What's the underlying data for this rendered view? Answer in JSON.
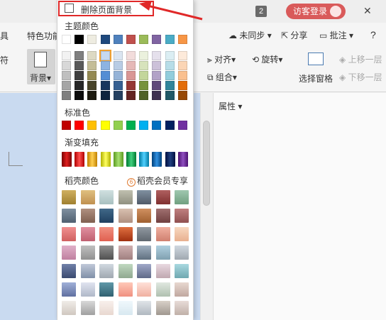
{
  "titlebar": {
    "badge": "2",
    "login_label": "访客登录",
    "close_glyph": "✕"
  },
  "menubar": {
    "left_cut": "具",
    "feature_tab": "特色功能",
    "sync_label": "未同步",
    "share_label": "分享",
    "comment_label": "批注",
    "help_glyph": "?"
  },
  "ribbon": {
    "left_cut": "符",
    "background_label": "背景",
    "align_label": "对齐",
    "rotate_label": "旋转",
    "group_label": "组合",
    "select_pane_label": "选择窗格",
    "up_label": "上移一层",
    "down_label": "下移一层"
  },
  "right_panel": {
    "title": "属性"
  },
  "bg_panel": {
    "delete_label": "删除页面背景",
    "theme_title": "主题颜色",
    "standard_title": "标准色",
    "gradient_title": "渐变填充",
    "shell_title": "稻壳颜色",
    "member_label": "稻壳会员专享",
    "theme_top": [
      "#ffffff",
      "#000000",
      "#eeece1",
      "#1f497d",
      "#4f81bd",
      "#c0504d",
      "#9bbb59",
      "#8064a2",
      "#4bacc6",
      "#f79646"
    ],
    "theme_grid": [
      [
        "#f2f2f2",
        "#7f7f7f",
        "#ddd9c3",
        "#c6d9f0",
        "#dbe5f1",
        "#f2dcdb",
        "#ebf1dd",
        "#e5e0ec",
        "#dbeef3",
        "#fdeada"
      ],
      [
        "#d8d8d8",
        "#595959",
        "#c4bd97",
        "#8db3e2",
        "#b8cce4",
        "#e5b9b7",
        "#d7e3bc",
        "#ccc1d9",
        "#b7dde8",
        "#fbd5b5"
      ],
      [
        "#bfbfbf",
        "#3f3f3f",
        "#938953",
        "#548dd4",
        "#95b3d7",
        "#d99694",
        "#c3d69b",
        "#b2a2c7",
        "#92cddc",
        "#fac08f"
      ],
      [
        "#a5a5a5",
        "#262626",
        "#494429",
        "#17365d",
        "#366092",
        "#953734",
        "#76923c",
        "#5f497a",
        "#31859b",
        "#e36c09"
      ],
      [
        "#7f7f7f",
        "#0c0c0c",
        "#1d1b10",
        "#0f243e",
        "#244061",
        "#632423",
        "#4f6128",
        "#3f3151",
        "#205867",
        "#974806"
      ]
    ],
    "standard": [
      "#c00000",
      "#ff0000",
      "#ffc000",
      "#ffff00",
      "#92d050",
      "#00b050",
      "#00b0f0",
      "#0070c0",
      "#002060",
      "#7030a0"
    ],
    "gradient": [
      [
        "#7a0000",
        "#e02020"
      ],
      [
        "#b00000",
        "#ff5050"
      ],
      [
        "#c08000",
        "#ffd050"
      ],
      [
        "#b0b000",
        "#ffff60"
      ],
      [
        "#5a9a20",
        "#a8e070"
      ],
      [
        "#007a30",
        "#40d080"
      ],
      [
        "#007aa0",
        "#50d0ff"
      ],
      [
        "#00407a",
        "#3090e0"
      ],
      [
        "#001040",
        "#204080"
      ],
      [
        "#4a1070",
        "#9050c0"
      ]
    ],
    "shell": [
      [
        [
          "#a08030",
          "#d0b060"
        ],
        [
          "#c09050",
          "#e0c080"
        ],
        [
          "#a8c0c0",
          "#d0e0e0"
        ],
        [
          "#909080",
          "#c0c0b0"
        ],
        [
          "#505a68",
          "#8090a0"
        ],
        [
          "#803030",
          "#b06060"
        ],
        [
          "#70a080",
          "#a0c8b0"
        ]
      ],
      [
        [
          "#506070",
          "#8090a0"
        ],
        [
          "#806050",
          "#b09080"
        ],
        [
          "#204060",
          "#406888"
        ],
        [
          "#b09080",
          "#d8c0b0"
        ],
        [
          "#a06030",
          "#d09060"
        ],
        [
          "#704040",
          "#a07070"
        ],
        [
          "#905050",
          "#c08080"
        ]
      ],
      [
        [
          "#d06060",
          "#f09090"
        ],
        [
          "#c06070",
          "#e090a0"
        ],
        [
          "#e06050",
          "#f09080"
        ],
        [
          "#a03010",
          "#e07040"
        ],
        [
          "#606870",
          "#9098a0"
        ],
        [
          "#d08070",
          "#f0b0a0"
        ],
        [
          "#e8b090",
          "#f8d8c0"
        ]
      ],
      [
        [
          "#c080a0",
          "#e0b0c8"
        ],
        [
          "#909090",
          "#c0c0c0"
        ],
        [
          "#505050",
          "#909090"
        ],
        [
          "#a08080",
          "#d0b0b0"
        ],
        [
          "#607080",
          "#a0b0c0"
        ],
        [
          "#80a0b0",
          "#b0d0e0"
        ],
        [
          "#a0a8b0",
          "#d0d8e0"
        ]
      ],
      [
        [
          "#3a4a70",
          "#7080a8"
        ],
        [
          "#8090a8",
          "#c0c8d8"
        ],
        [
          "#a0a8b0",
          "#d0d8e0"
        ],
        [
          "#90a890",
          "#c0d8c0"
        ],
        [
          "#606a88",
          "#a0a8c8"
        ],
        [
          "#c0a8b0",
          "#e8d8e0"
        ],
        [
          "#70a8b0",
          "#a8d8e0"
        ]
      ],
      [
        [
          "#6070a0",
          "#a0b0d8"
        ],
        [
          "#b0b8c8",
          "#e0e4f0"
        ],
        [
          "#306070",
          "#6098a8"
        ],
        [
          "#f09080",
          "#ffc8b8"
        ],
        [
          "#f0b0a0",
          "#ffe0d8"
        ],
        [
          "#b0c0b0",
          "#e0e8e0"
        ],
        [
          "#c0a8a0",
          "#e8d8d0"
        ]
      ],
      [
        [
          "#d0c8c0",
          "#f0ece8"
        ],
        [
          "#a0a0a0",
          "#d8d8d8"
        ],
        [
          "#e8d8d0",
          "#f8f0ec"
        ],
        [
          "#d8e8f0",
          "#f0f8fc"
        ],
        [
          "#b0b8c0",
          "#e0e4e8"
        ],
        [
          "#a09890",
          "#d8d0c8"
        ],
        [
          "#c0b0a8",
          "#e8dcd8"
        ]
      ]
    ]
  }
}
